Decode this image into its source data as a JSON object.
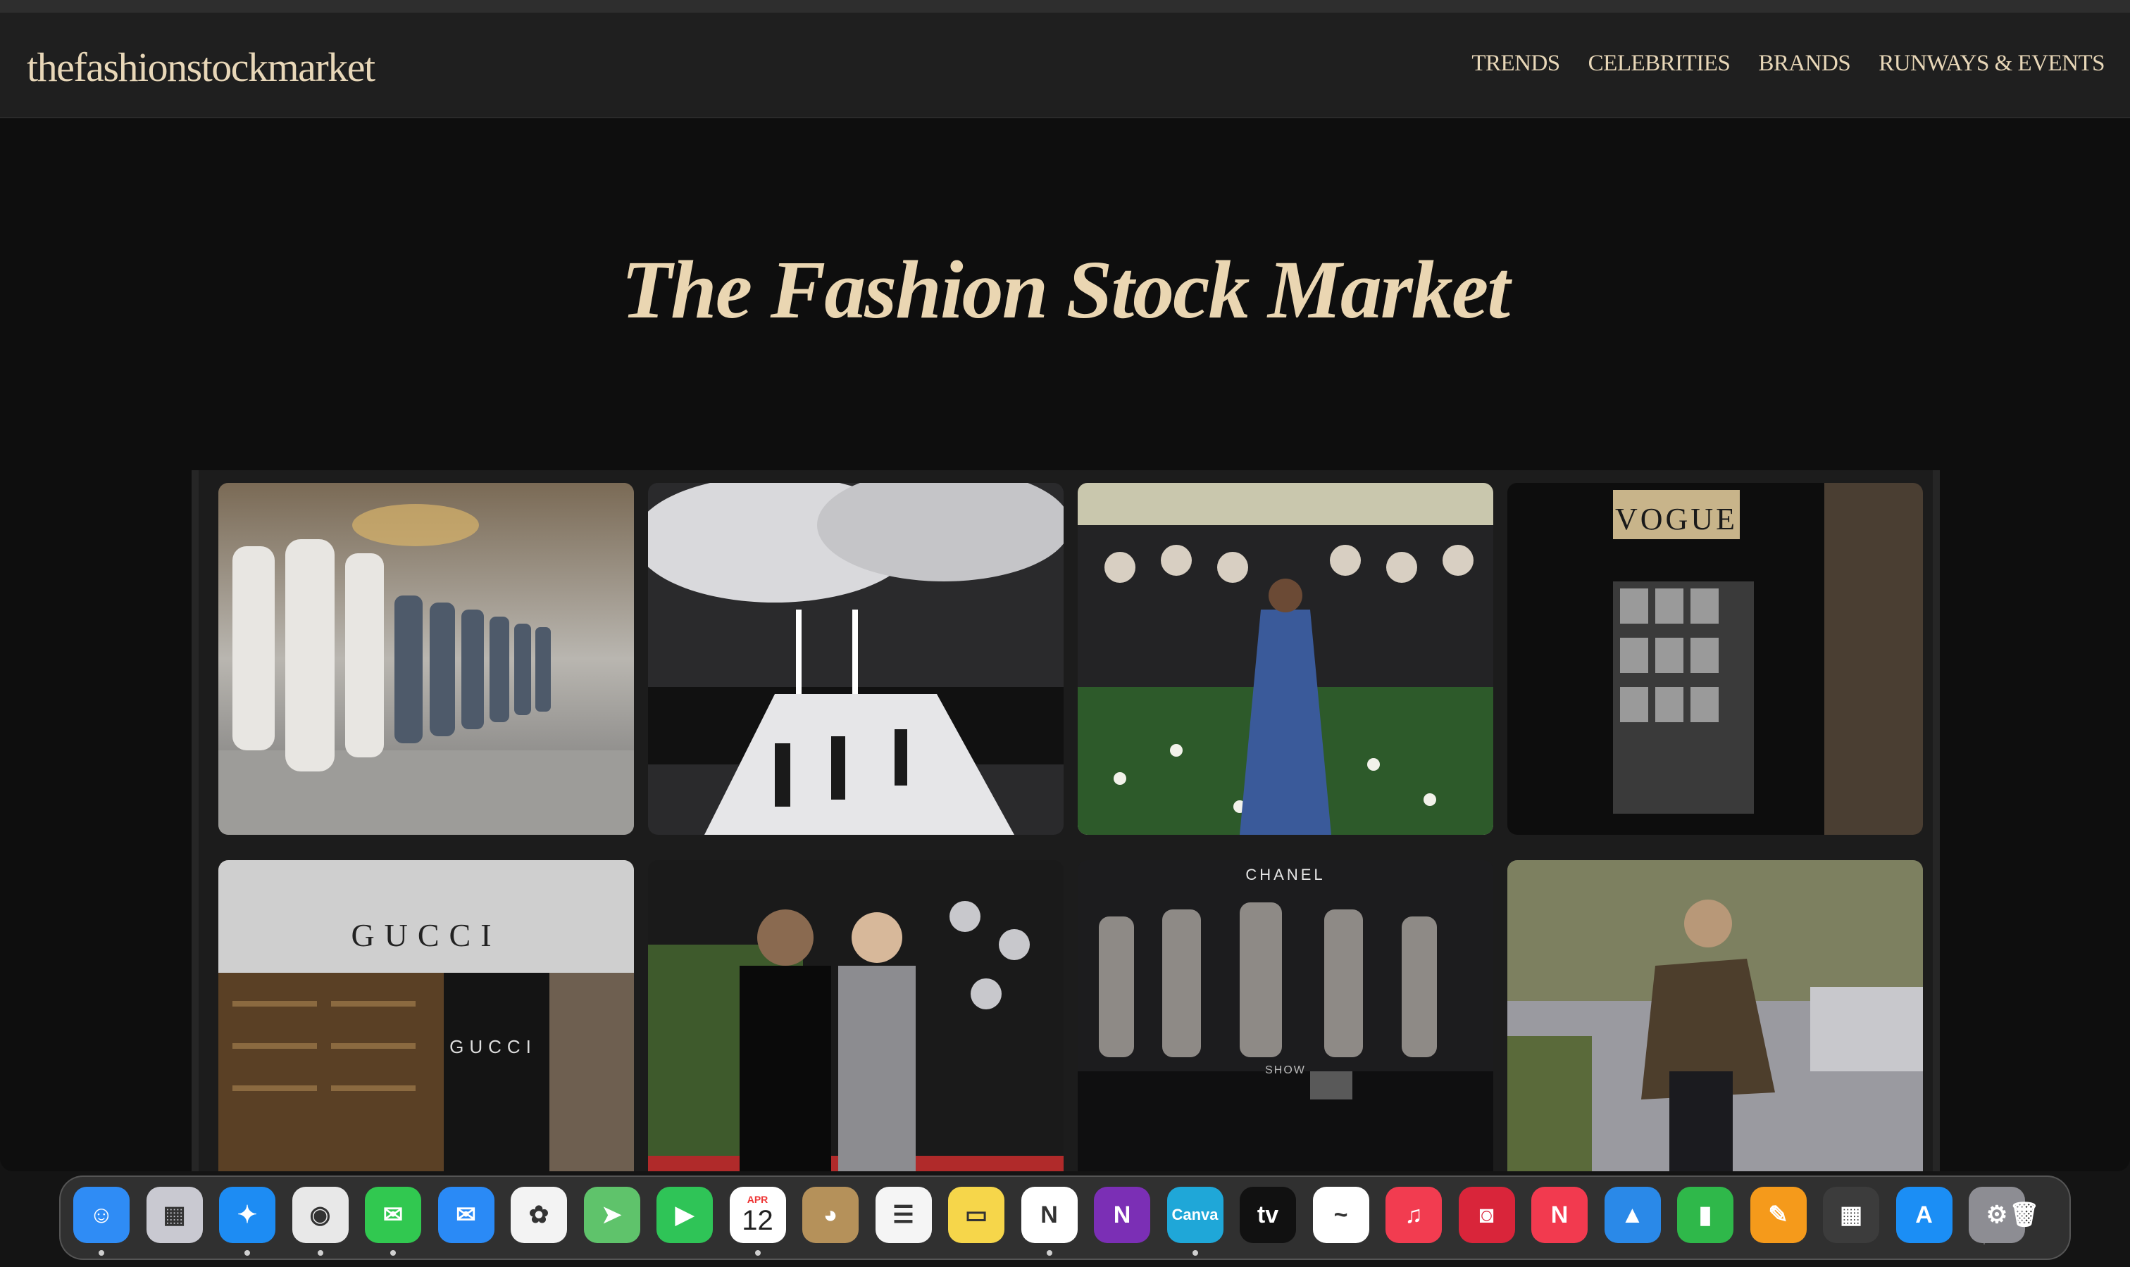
{
  "site": {
    "logo": "thefashionstockmarket",
    "nav": [
      "TRENDS",
      "CELEBRITIES",
      "BRANDS",
      "RUNWAYS & EVENTS"
    ],
    "hero_title": "The Fashion Stock Market"
  },
  "gallery": {
    "tiles": [
      {
        "name": "runway-models-photo"
      },
      {
        "name": "runway-show-photo"
      },
      {
        "name": "met-gala-zendaya-photo"
      },
      {
        "name": "vogue-newsstand-photo",
        "caption": "VOGUE"
      },
      {
        "name": "gucci-store-photo",
        "caption": "GUCCI"
      },
      {
        "name": "celebrity-couple-photo"
      },
      {
        "name": "chanel-show-photo",
        "caption": "CHANEL",
        "sub": "SHOW"
      },
      {
        "name": "street-style-photo"
      }
    ]
  },
  "dock": {
    "calendar_month": "APR",
    "calendar_day": "12",
    "apps": [
      {
        "name": "finder",
        "label": "☺",
        "color": "#2f8cf5",
        "running": true
      },
      {
        "name": "launchpad",
        "label": "▦",
        "color": "#c9c9d1",
        "running": false
      },
      {
        "name": "safari",
        "label": "✦",
        "color": "#1d8cf3",
        "running": true
      },
      {
        "name": "chrome",
        "label": "◉",
        "color": "#e8e8e8",
        "running": true
      },
      {
        "name": "messages",
        "label": "✉",
        "color": "#31c850",
        "running": true
      },
      {
        "name": "mail",
        "label": "✉",
        "color": "#2a8af6",
        "running": false
      },
      {
        "name": "photos",
        "label": "✿",
        "color": "#f3f3f3",
        "running": false
      },
      {
        "name": "maps",
        "label": "➤",
        "color": "#5fc36b",
        "running": false
      },
      {
        "name": "facetime",
        "label": "▶",
        "color": "#2fc457",
        "running": false
      },
      {
        "name": "calendar",
        "label": "",
        "color": "#ffffff",
        "running": true
      },
      {
        "name": "contacts",
        "label": "◕",
        "color": "#b5915a",
        "running": false
      },
      {
        "name": "reminders",
        "label": "☰",
        "color": "#f5f5f5",
        "running": false
      },
      {
        "name": "notes",
        "label": "▭",
        "color": "#f6d64a",
        "running": false
      },
      {
        "name": "notion",
        "label": "N",
        "color": "#ffffff",
        "running": true
      },
      {
        "name": "onenote",
        "label": "N",
        "color": "#7b2fb5",
        "running": false
      },
      {
        "name": "canva",
        "label": "Canva",
        "color": "#1fa7d8",
        "running": true
      },
      {
        "name": "apple-tv",
        "label": "tv",
        "color": "#111111",
        "running": false
      },
      {
        "name": "freeform",
        "label": "~",
        "color": "#ffffff",
        "running": false
      },
      {
        "name": "music",
        "label": "♫",
        "color": "#f23c50",
        "running": false
      },
      {
        "name": "photo-booth",
        "label": "◙",
        "color": "#d9253a",
        "running": false
      },
      {
        "name": "news",
        "label": "N",
        "color": "#f23a4f",
        "running": false
      },
      {
        "name": "keynote",
        "label": "▲",
        "color": "#2a89e8",
        "running": false
      },
      {
        "name": "numbers",
        "label": "▮",
        "color": "#2fb84a",
        "running": false
      },
      {
        "name": "pages",
        "label": "✎",
        "color": "#f59a1b",
        "running": false
      },
      {
        "name": "calculator",
        "label": "▦",
        "color": "#3c3c3c",
        "running": false
      },
      {
        "name": "app-store",
        "label": "A",
        "color": "#1b8ef5",
        "running": false
      },
      {
        "name": "system-settings",
        "label": "⚙",
        "color": "#8d8d93",
        "running": false
      },
      {
        "name": "trash",
        "label": "🗑",
        "color": "rgba(0,0,0,0)",
        "running": false
      }
    ]
  }
}
